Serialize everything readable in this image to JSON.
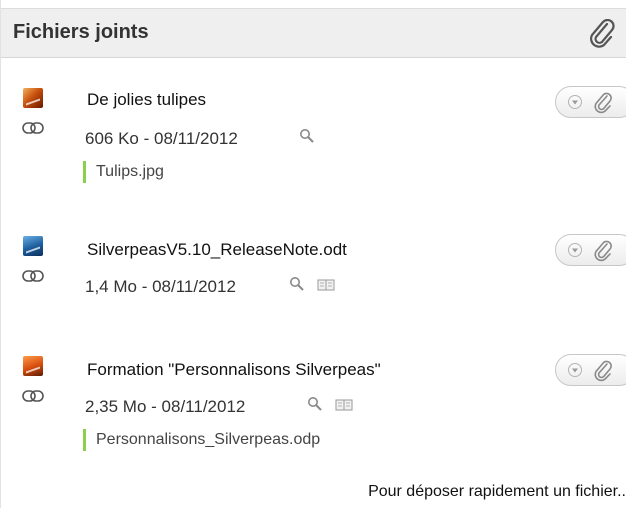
{
  "panel": {
    "title": "Fichiers joints",
    "header_icon": "paperclip-icon"
  },
  "attachments": [
    {
      "title": "De jolies tulipes",
      "info": "606 Ko - 08/11/2012",
      "filename": "Tulips.jpg",
      "file_icon": "image-file-icon"
    },
    {
      "title": "SilverpeasV5.10_ReleaseNote.odt",
      "info": "1,4 Mo - 08/11/2012",
      "filename": "",
      "file_icon": "text-document-icon"
    },
    {
      "title": "Formation \"Personnalisons Silverpeas\"",
      "info": "2,35 Mo - 08/11/2012",
      "filename": "Personnalisons_Silverpeas.odp",
      "file_icon": "presentation-file-icon"
    }
  ],
  "footer": {
    "dropzone_hint": "Pour déposer rapidement un fichier.."
  },
  "colors": {
    "header_bg": "#efefef",
    "filename_accent": "#8cd04a"
  }
}
